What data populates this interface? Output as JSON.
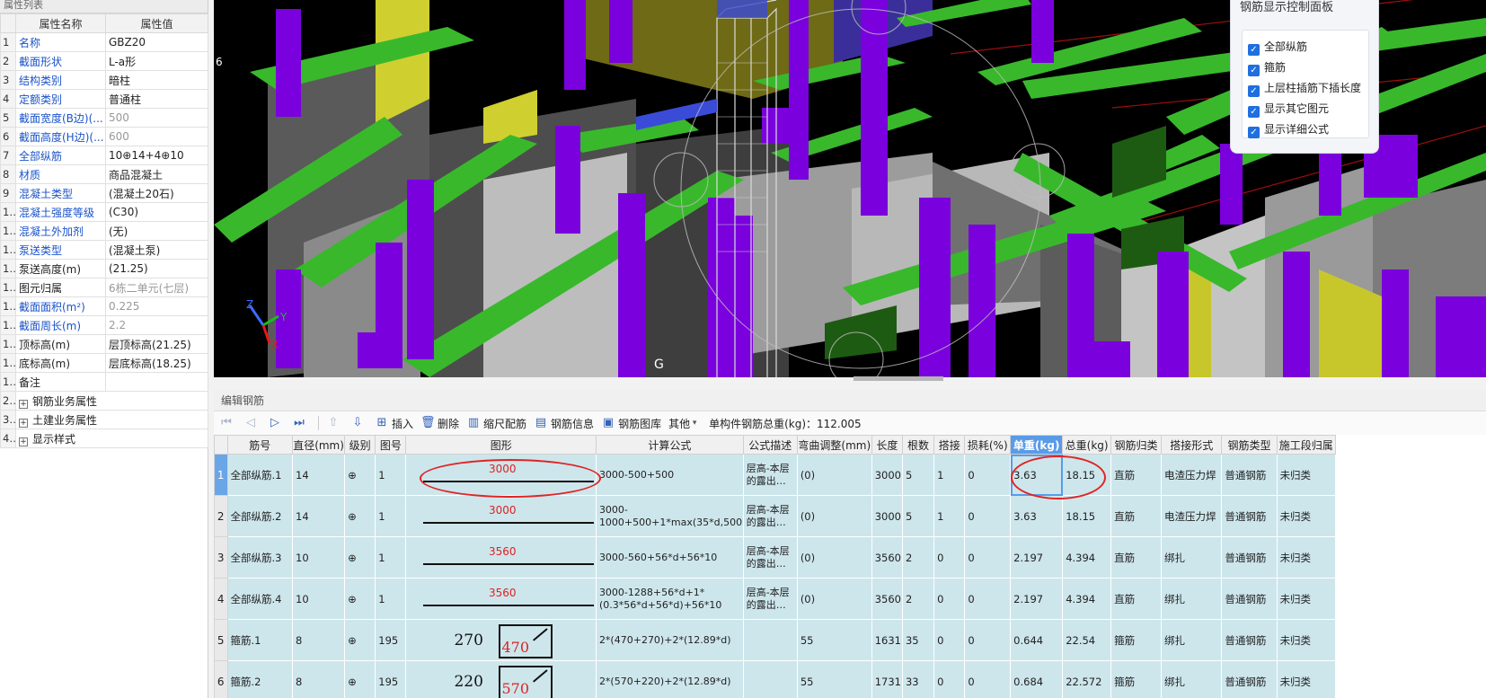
{
  "property_panel": {
    "title": "属性列表",
    "col_name": "属性名称",
    "col_value": "属性值",
    "rows": [
      {
        "idx": "1",
        "name": "名称",
        "value": "GBZ20",
        "blue": true,
        "gray": false
      },
      {
        "idx": "2",
        "name": "截面形状",
        "value": "L-a形",
        "blue": true,
        "gray": false
      },
      {
        "idx": "3",
        "name": "结构类别",
        "value": "暗柱",
        "blue": true,
        "gray": false
      },
      {
        "idx": "4",
        "name": "定额类别",
        "value": "普通柱",
        "blue": true,
        "gray": false
      },
      {
        "idx": "5",
        "name": "截面宽度(B边)(...",
        "value": "500",
        "blue": true,
        "gray": true
      },
      {
        "idx": "6",
        "name": "截面高度(H边)(...",
        "value": "600",
        "blue": true,
        "gray": true
      },
      {
        "idx": "7",
        "name": "全部纵筋",
        "value": "10⊕14+4⊕10",
        "blue": true,
        "gray": false
      },
      {
        "idx": "8",
        "name": "材质",
        "value": "商品混凝土",
        "blue": true,
        "gray": false
      },
      {
        "idx": "9",
        "name": "混凝土类型",
        "value": "(混凝土20石)",
        "blue": true,
        "gray": false
      },
      {
        "idx": "10",
        "name": "混凝土强度等级",
        "value": "(C30)",
        "blue": true,
        "gray": false
      },
      {
        "idx": "11",
        "name": "混凝土外加剂",
        "value": "(无)",
        "blue": true,
        "gray": false
      },
      {
        "idx": "12",
        "name": "泵送类型",
        "value": "(混凝土泵)",
        "blue": true,
        "gray": false
      },
      {
        "idx": "13",
        "name": "泵送高度(m)",
        "value": "(21.25)",
        "blue": false,
        "gray": false
      },
      {
        "idx": "14",
        "name": "图元归属",
        "value": "6栋二单元(七层)",
        "blue": false,
        "gray": true
      },
      {
        "idx": "15",
        "name": "截面面积(m²)",
        "value": "0.225",
        "blue": true,
        "gray": true
      },
      {
        "idx": "16",
        "name": "截面周长(m)",
        "value": "2.2",
        "blue": true,
        "gray": true
      },
      {
        "idx": "17",
        "name": "顶标高(m)",
        "value": "层顶标高(21.25)",
        "blue": false,
        "gray": false
      },
      {
        "idx": "18",
        "name": "底标高(m)",
        "value": "层底标高(18.25)",
        "blue": false,
        "gray": false
      },
      {
        "idx": "19",
        "name": "备注",
        "value": "",
        "blue": false,
        "gray": false
      }
    ],
    "groups": [
      {
        "idx": "20",
        "label": "钢筋业务属性"
      },
      {
        "idx": "34",
        "label": "土建业务属性"
      },
      {
        "idx": "40",
        "label": "显示样式"
      }
    ]
  },
  "viewport": {
    "axis_labels": {
      "x": "X",
      "y": "Y",
      "z": "Z"
    },
    "grid_label": "G",
    "top_label": "6"
  },
  "rebar_display_panel": {
    "title": "钢筋显示控制面板",
    "options": [
      {
        "label": "全部纵筋",
        "checked": true
      },
      {
        "label": "箍筋",
        "checked": true
      },
      {
        "label": "上层柱插筋下插长度",
        "checked": true
      },
      {
        "label": "显示其它图元",
        "checked": true
      },
      {
        "label": "显示详细公式",
        "checked": true
      }
    ]
  },
  "edit_rebar": {
    "title": "编辑钢筋",
    "toolbar": {
      "insert": "插入",
      "delete": "删除",
      "scale": "缩尺配筋",
      "info": "钢筋信息",
      "library": "钢筋图库",
      "other": "其他",
      "total_label": "单构件钢筋总重(kg)：112.005"
    },
    "columns": [
      "筋号",
      "直径(mm)",
      "级别",
      "图号",
      "图形",
      "计算公式",
      "公式描述",
      "弯曲调整(mm)",
      "长度",
      "根数",
      "搭接",
      "损耗(%)",
      "单重(kg)",
      "总重(kg)",
      "钢筋归类",
      "搭接形式",
      "钢筋类型",
      "施工段归属"
    ],
    "rows": [
      {
        "idx": "1",
        "name": "全部纵筋.1",
        "dia": "14",
        "grade": "⊕",
        "fig": "1",
        "shape": "3000",
        "shape_b": "",
        "formula": "3000-500+500",
        "desc": "层高-本层的露出…",
        "bend": "(0)",
        "length": "3000",
        "count": "5",
        "lap": "1",
        "loss": "0",
        "unit": "3.63",
        "total": "18.15",
        "cat": "直筋",
        "lap_type": "电渣压力焊",
        "type": "普通钢筋",
        "seg": "未归类"
      },
      {
        "idx": "2",
        "name": "全部纵筋.2",
        "dia": "14",
        "grade": "⊕",
        "fig": "1",
        "shape": "3000",
        "shape_b": "",
        "formula": "3000-1000+500+1*max(35*d,500)",
        "desc": "层高-本层的露出…",
        "bend": "(0)",
        "length": "3000",
        "count": "5",
        "lap": "1",
        "loss": "0",
        "unit": "3.63",
        "total": "18.15",
        "cat": "直筋",
        "lap_type": "电渣压力焊",
        "type": "普通钢筋",
        "seg": "未归类"
      },
      {
        "idx": "3",
        "name": "全部纵筋.3",
        "dia": "10",
        "grade": "⊕",
        "fig": "1",
        "shape": "3560",
        "shape_b": "",
        "formula": "3000-560+56*d+56*10",
        "desc": "层高-本层的露出…",
        "bend": "(0)",
        "length": "3560",
        "count": "2",
        "lap": "0",
        "loss": "0",
        "unit": "2.197",
        "total": "4.394",
        "cat": "直筋",
        "lap_type": "绑扎",
        "type": "普通钢筋",
        "seg": "未归类"
      },
      {
        "idx": "4",
        "name": "全部纵筋.4",
        "dia": "10",
        "grade": "⊕",
        "fig": "1",
        "shape": "3560",
        "shape_b": "",
        "formula": "3000-1288+56*d+1*(0.3*56*d+56*d)+56*10",
        "desc": "层高-本层的露出…",
        "bend": "(0)",
        "length": "3560",
        "count": "2",
        "lap": "0",
        "loss": "0",
        "unit": "2.197",
        "total": "4.394",
        "cat": "直筋",
        "lap_type": "绑扎",
        "type": "普通钢筋",
        "seg": "未归类"
      },
      {
        "idx": "5",
        "name": "箍筋.1",
        "dia": "8",
        "grade": "⊕",
        "fig": "195",
        "shape": "270",
        "shape_b": "470",
        "formula": "2*(470+270)+2*(12.89*d)",
        "desc": "",
        "bend": "55",
        "length": "1631",
        "count": "35",
        "lap": "0",
        "loss": "0",
        "unit": "0.644",
        "total": "22.54",
        "cat": "箍筋",
        "lap_type": "绑扎",
        "type": "普通钢筋",
        "seg": "未归类"
      },
      {
        "idx": "6",
        "name": "箍筋.2",
        "dia": "8",
        "grade": "⊕",
        "fig": "195",
        "shape": "220",
        "shape_b": "570",
        "formula": "2*(570+220)+2*(12.89*d)",
        "desc": "",
        "bend": "55",
        "length": "1731",
        "count": "33",
        "lap": "0",
        "loss": "0",
        "unit": "0.684",
        "total": "22.572",
        "cat": "箍筋",
        "lap_type": "绑扎",
        "type": "普通钢筋",
        "seg": "未归类"
      }
    ]
  }
}
